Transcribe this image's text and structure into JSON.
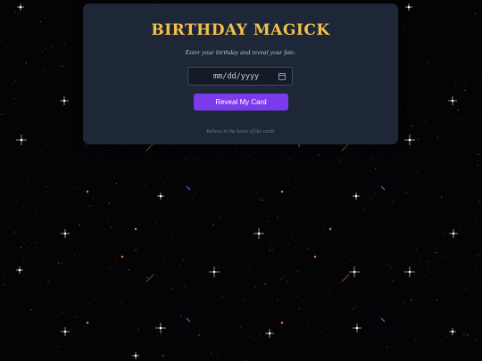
{
  "card": {
    "title": "BIRTHDAY MAGICK",
    "subtitle": "Enter your birthday and reveal your fate.",
    "date_input": {
      "placeholder": "mm/dd/yyyy",
      "value": ""
    },
    "button_label": "Reveal My Card",
    "footer": "Believe in the heart of the cards"
  },
  "colors": {
    "background": "#050507",
    "card_background": "#1e2738",
    "title": "#f2c14e",
    "button": "#7c3aed",
    "star": "#ffffff",
    "star_warm": "#ff7a3d",
    "star_cool": "#6b6bff"
  },
  "icons": {
    "date_picker": "calendar-icon"
  }
}
